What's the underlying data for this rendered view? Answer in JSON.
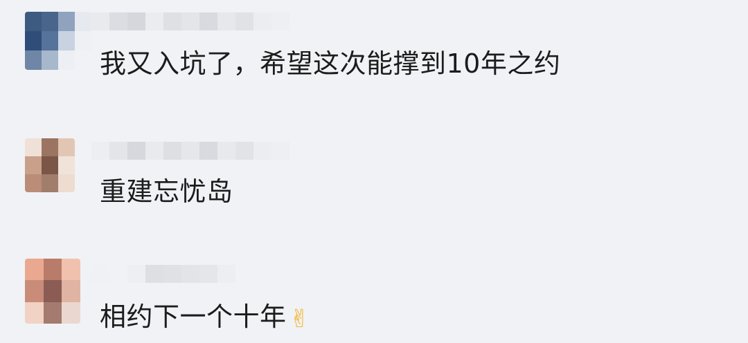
{
  "comments": [
    {
      "text": "我又入坑了，希望这次能撑到10年之约",
      "avatar_colors": [
        "#3d5a80",
        "#49658c",
        "#8fa3bf",
        "#e6e9ef",
        "#2f4d78",
        "#55739b",
        "#c8d2e0",
        "#eef0f4",
        "#6f86a6",
        "#a7b7cc",
        "#eceff3",
        "#f1f2f6"
      ],
      "name_colors": [
        "#e9eaee",
        "#dcdde2",
        "#d6d7dc",
        "#ebecef",
        "#dfe0e4",
        "#e4e5e9",
        "#d9dadf",
        "#e7e8ec",
        "#e1e2e6",
        "#ecedf0",
        "#eeeff2"
      ]
    },
    {
      "text": "重建忘忧岛",
      "avatar_colors": [
        "#efe1d8",
        "#9c7462",
        "#e2c6b4",
        "#c9a08a",
        "#7a5548",
        "#f0e3d9",
        "#bb8d78",
        "#a17d6c",
        "#eedcd0"
      ],
      "name_colors": [
        "#eceef1",
        "#e4e5e9",
        "#d7d8dd",
        "#e9eaee",
        "#dedfe3",
        "#e6e7eb",
        "#d9dadf",
        "#e8e9ed",
        "#e2e3e7",
        "#ecedf0",
        "#eeeff2"
      ]
    },
    {
      "text": "相约下一个十年",
      "emoji": "✌",
      "avatar_colors": [
        "#e9a88f",
        "#b97c6a",
        "#f0c2ae",
        "#c98c78",
        "#8a5c54",
        "#e0b4a2",
        "#f1d2c4",
        "#a57a6f",
        "#ead8d0"
      ],
      "name_colors": [
        "#f0f1f4",
        "#f1f2f5",
        "#eeeff2",
        "#dedfe3",
        "#e0e1e5",
        "#e3e4e8",
        "#e5e6ea",
        "#eceef1"
      ]
    }
  ]
}
